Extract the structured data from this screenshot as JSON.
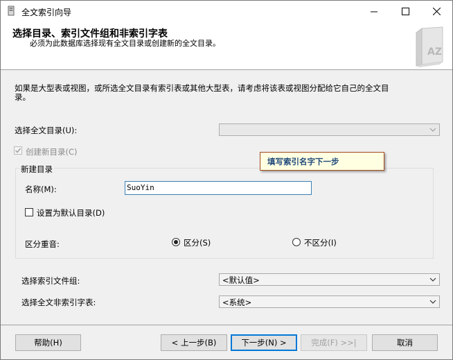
{
  "window": {
    "title": "全文索引向导"
  },
  "header": {
    "title": "选择目录、索引文件组和非索引字表",
    "subtitle": "必须为此数据库选择现有全文目录或创建新的全文目录。"
  },
  "description": "如果是大型表或视图，或所选全文目录有索引表或其他大型表，请考虑将该表或视图分配给它自己的全文目录。",
  "catalog": {
    "label": "选择全文目录(U):",
    "value": ""
  },
  "create_new": {
    "label": "创建新目录(C)",
    "checked": true,
    "enabled": false
  },
  "tooltip": "填写索引名字下一步",
  "new_catalog": {
    "group_title": "新建目录",
    "name_label": "名称(M):",
    "name_value": "SuoYin",
    "default_label": "设置为默认目录(D)",
    "default_checked": false,
    "accent_label": "区分重音:",
    "sensitive_label": "区分(S)",
    "insensitive_label": "不区分(I)",
    "accent_selected": "sensitive"
  },
  "filegroup": {
    "label": "选择索引文件组:",
    "value": "<默认值>"
  },
  "stoplist": {
    "label": "选择全文非索引字表:",
    "value": "<系统>"
  },
  "buttons": {
    "help": "帮助(H)",
    "back": "< 上一步(B)",
    "next": "下一步(N) >",
    "finish": "完成(F) >>|",
    "cancel": "取消"
  },
  "colors": {
    "accent": "#0078d7",
    "tooltip_bg": "#ffffe1",
    "tooltip_text": "#214a7c",
    "tooltip_border": "#a34a1f"
  }
}
